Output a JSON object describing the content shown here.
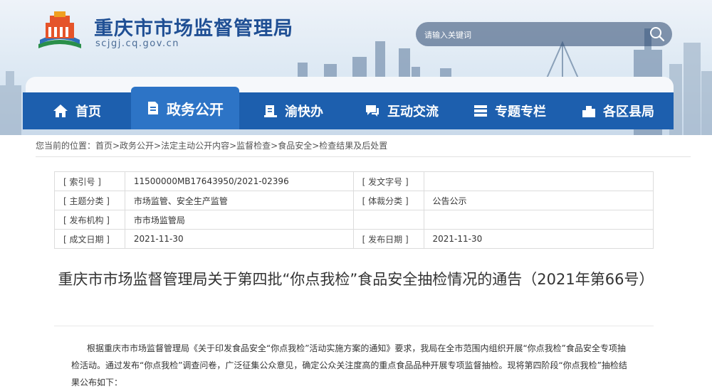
{
  "header": {
    "title": "重庆市市场监督管理局",
    "url": "scjgj.cq.gov.cn",
    "search_placeholder": "请输入关键词",
    "logo_icon": "emblem-logo-icon",
    "search_icon": "search-icon"
  },
  "nav": {
    "items": [
      {
        "label": "首页",
        "icon": "home-icon"
      },
      {
        "label": "政务公开",
        "icon": "document-icon",
        "active": true
      },
      {
        "label": "渝快办",
        "icon": "book-icon"
      },
      {
        "label": "互动交流",
        "icon": "chat-icon"
      },
      {
        "label": "专题专栏",
        "icon": "list-icon"
      },
      {
        "label": "各区县局",
        "icon": "building-icon"
      }
    ]
  },
  "breadcrumb": "您当前的位置：首页>政务公开>法定主动公开内容>监督检查>食品安全>检查结果及后处置",
  "meta": {
    "index_label": "[ 索引号 ]",
    "index_value": "11500000MB17643950/2021-02396",
    "doc_no_label": "[ 发文字号 ]",
    "doc_no_value": "",
    "topic_label": "[ 主题分类 ]",
    "topic_value": "市场监管、安全生产监管",
    "genre_label": "[ 体裁分类 ]",
    "genre_value": "公告公示",
    "issuer_label": "[ 发布机构 ]",
    "issuer_value": "市市场监管局",
    "created_label": "[ 成文日期 ]",
    "created_value": "2021-11-30",
    "published_label": "[ 发布日期 ]",
    "published_value": "2021-11-30"
  },
  "article": {
    "title": "重庆市市场监督管理局关于第四批“你点我检”食品安全抽检情况的通告（2021年第66号）",
    "paragraph": "根据重庆市市场监督管理局《关于印发食品安全“你点我检”活动实施方案的通知》要求，我局在全市范围内组织开展“你点我检”食品安全专项抽检活动。通过发布“你点我检”调查问卷，广泛征集公众意见，确定公众关注度高的重点食品品种开展专项监督抽检。现将第四阶段“你点我检”抽检结果公布如下："
  },
  "colors": {
    "brand_blue": "#1d5fae",
    "active_tab": "#2d74c6",
    "title_blue": "#1f4f94"
  }
}
